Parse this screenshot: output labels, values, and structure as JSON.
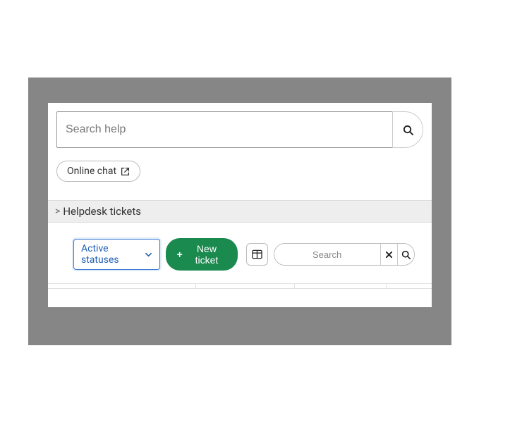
{
  "searchHelp": {
    "placeholder": "Search help"
  },
  "chat": {
    "label": "Online chat"
  },
  "section": {
    "prefix": ">",
    "title": "Helpdesk tickets"
  },
  "toolbar": {
    "statusDropdown": "Active statuses",
    "newTicketLabel": "New ticket",
    "filterSearchPlaceholder": "Search"
  }
}
